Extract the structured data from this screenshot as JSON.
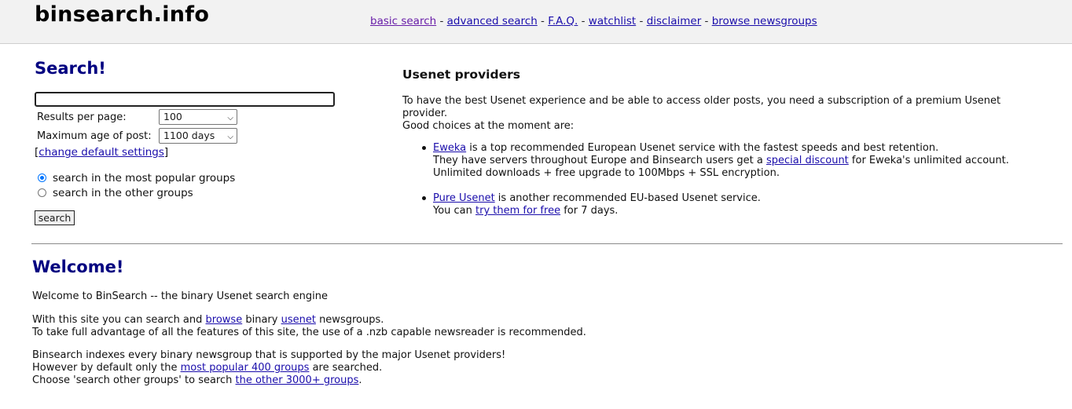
{
  "header": {
    "logo": "binsearch.info",
    "nav": [
      {
        "label": "basic search"
      },
      {
        "label": "advanced search"
      },
      {
        "label": "F.A.Q."
      },
      {
        "label": "watchlist"
      },
      {
        "label": "disclaimer"
      },
      {
        "label": "browse newsgroups"
      }
    ],
    "separator": "-"
  },
  "search": {
    "title": "Search!",
    "query_value": "",
    "results_per_page_label": "Results per page:",
    "results_per_page_value": "100",
    "max_age_label": "Maximum age of post:",
    "max_age_value": "1100 days",
    "change_settings_open": "[",
    "change_settings_link": "change default settings",
    "change_settings_close": "]",
    "radio_popular": "search in the most popular groups",
    "radio_other": "search in the other groups",
    "selected_scope": "popular",
    "button_label": "search"
  },
  "providers": {
    "title": "Usenet providers",
    "intro_line1": "To have the best Usenet experience and be able to access older posts, you need a subscription of a premium Usenet provider.",
    "intro_line2": "Good choices at the moment are:",
    "eweka": {
      "link": "Eweka",
      "text1": " is a top recommended European Usenet service with the fastest speeds and best retention.",
      "text2a": "They have servers throughout Europe and Binsearch users get a ",
      "discount_link": "special discount",
      "text2b": " for Eweka's unlimited account.",
      "text3": "Unlimited downloads + free upgrade to 100Mbps + SSL encryption."
    },
    "pure": {
      "link": "Pure Usenet",
      "text1": " is another recommended EU-based Usenet service.",
      "text2a": "You can ",
      "try_link": "try them for free",
      "text2b": " for 7 days."
    }
  },
  "welcome": {
    "title": "Welcome!",
    "line1": "Welcome to BinSearch -- the binary Usenet search engine",
    "p2a": "With this site you can search and ",
    "browse_link": "browse",
    "p2b": " binary ",
    "usenet_link": "usenet",
    "p2c": " newsgroups.",
    "p2_line2": "To take full advantage of all the features of this site, the use of a .nzb capable newsreader is recommended.",
    "p3_line1": "Binsearch indexes every binary newsgroup that is supported by the major Usenet providers!",
    "p3_line2a": "However by default only the ",
    "popular_link": "most popular 400 groups",
    "p3_line2b": " are searched.",
    "p3_line3a": "Choose 'search other groups' to search ",
    "other_link": "the other 3000+ groups",
    "p3_line3b": "."
  },
  "colors": {
    "heading": "#000080",
    "link": "#1a0dab",
    "visited_link": "#681da8",
    "topbar": "#f2f2f2"
  }
}
